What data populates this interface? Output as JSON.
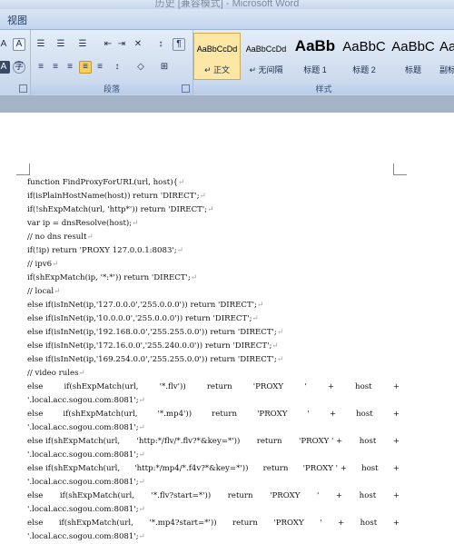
{
  "window": {
    "title": "历史 [兼容模式] - Microsoft Word"
  },
  "menu": {
    "view": "视图"
  },
  "ribbon": {
    "paragraph_label": "段落",
    "styles_label": "样式",
    "styles": [
      {
        "preview": "AaBbCcDd",
        "name": "↵ 正文"
      },
      {
        "preview": "AaBbCcDd",
        "name": "↵ 无间隔"
      },
      {
        "preview": "AaBb",
        "name": "标题 1"
      },
      {
        "preview": "AaBbC",
        "name": "标题 2"
      },
      {
        "preview": "AaBbC",
        "name": "标题"
      },
      {
        "preview": "AaB",
        "name": "副标"
      }
    ]
  },
  "document": {
    "paragraph_mark": "↵",
    "lines": [
      "function FindProxyForURL(url, host){",
      "if(isPlainHostName(host)) return 'DIRECT';",
      "if(!shExpMatch(url, 'http*')) return 'DIRECT';",
      "var ip = dnsResolve(host);",
      "// no dns result",
      "if(!ip) return 'PROXY 127.0.0.1:8083';",
      "// ipv6",
      "if(shExpMatch(ip, '*:*')) return 'DIRECT';",
      "// local",
      "else if(isInNet(ip,'127.0.0.0','255.0.0.0')) return 'DIRECT';",
      "else if(isInNet(ip,'10.0.0.0','255.0.0.0')) return 'DIRECT';",
      "else if(isInNet(ip,'192.168.0.0','255.255.0.0')) return 'DIRECT';",
      "else if(isInNet(ip,'172.16.0.0','255.240.0.0')) return 'DIRECT';",
      "else if(isInNet(ip,'169.254.0.0','255.255.0.0')) return 'DIRECT';",
      "// video rules"
    ],
    "rules": [
      {
        "parts": [
          "else",
          "if(shExpMatch(url,",
          "'*.flv'))",
          "return",
          "'PROXY",
          "'",
          "+",
          "host",
          "+"
        ],
        "cont": "'.local.acc.sogou.com:8081';"
      },
      {
        "parts": [
          "else",
          "if(shExpMatch(url,",
          "'*.mp4'))",
          "return",
          "'PROXY",
          "'",
          "+",
          "host",
          "+"
        ],
        "cont": "'.local.acc.sogou.com:8081';"
      },
      {
        "parts": [
          "else if(shExpMatch(url,",
          "'http:*/flv/*.flv?*&key=*'))",
          "return",
          "'PROXY ' +",
          "host",
          "+"
        ],
        "cont": "'.local.acc.sogou.com:8081';"
      },
      {
        "parts": [
          "else if(shExpMatch(url,",
          "'http:*/mp4/*.f4v?*&key=*'))",
          "return",
          "'PROXY ' +",
          "host",
          "+"
        ],
        "cont": "'.local.acc.sogou.com:8081';"
      },
      {
        "parts": [
          "else",
          "if(shExpMatch(url,",
          "'*.flv?start=*'))",
          "return",
          "'PROXY",
          "'",
          "+",
          "host",
          "+"
        ],
        "cont": "'.local.acc.sogou.com:8081';"
      },
      {
        "parts": [
          "else",
          "if(shExpMatch(url,",
          "'*.mp4?start=*'))",
          "return",
          "'PROXY",
          "'",
          "+",
          "host",
          "+"
        ],
        "cont": "'.local.acc.sogou.com:8081';"
      }
    ]
  }
}
